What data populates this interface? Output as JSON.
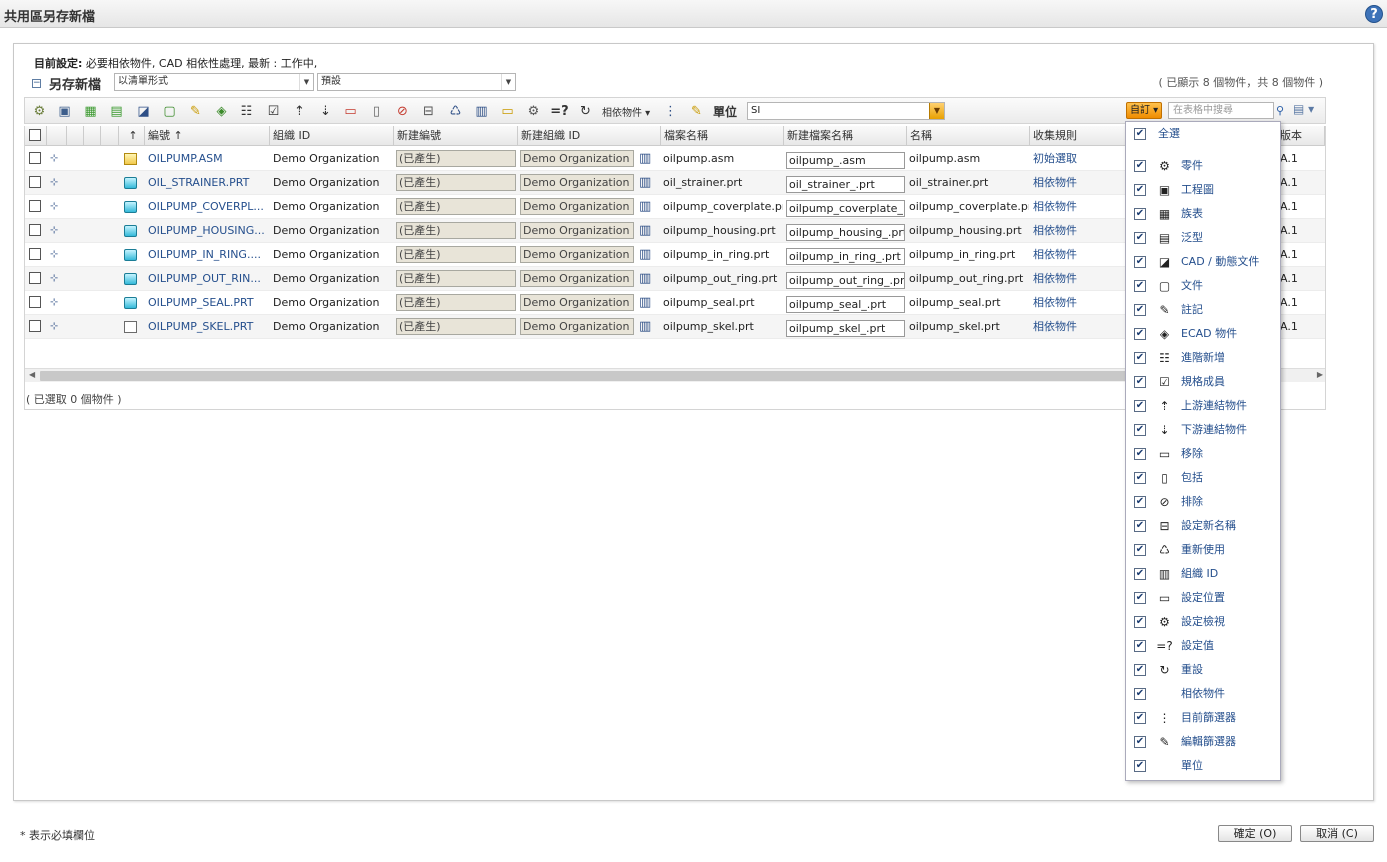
{
  "window": {
    "title": "共用區另存新檔",
    "help_label": "?"
  },
  "current_settings": {
    "label": "目前設定:",
    "value": "必要相依物件, CAD 相依性處理, 最新 : 工作中,"
  },
  "section": {
    "collapse_symbol": "−",
    "title": "另存新檔",
    "mode_select": "以清單形式",
    "preset_select": "預設",
    "shown_count": "( 已顯示 8 個物件，共 8 個物件 )"
  },
  "toolbar": {
    "dependents_label": "相依物件",
    "unit_label": "單位",
    "unit_value": "SI",
    "customize_label": "自訂",
    "search_placeholder": "在表格中搜尋"
  },
  "columns": [
    "↑",
    "編號 ↑",
    "組織 ID",
    "新建編號",
    "新建組織 ID",
    "檔案名稱",
    "新建檔案名稱",
    "名稱",
    "收集規則",
    "版本"
  ],
  "rows": [
    {
      "number": "OILPUMP.ASM",
      "org": "Demo Organization",
      "new_number": "(已產生)",
      "new_org": "Demo Organization",
      "file": "oilpump.asm",
      "new_file": "oilpump_.asm",
      "name": "oilpump.asm",
      "rule": "初始選取",
      "version": "A.1",
      "icon": "assembly"
    },
    {
      "number": "OIL_STRAINER.PRT",
      "org": "Demo Organization",
      "new_number": "(已產生)",
      "new_org": "Demo Organization",
      "file": "oil_strainer.prt",
      "new_file": "oil_strainer_.prt",
      "name": "oil_strainer.prt",
      "rule": "相依物件",
      "version": "A.1",
      "icon": "part"
    },
    {
      "number": "OILPUMP_COVERPL...",
      "org": "Demo Organization",
      "new_number": "(已產生)",
      "new_org": "Demo Organization",
      "file": "oilpump_coverplate.prt",
      "new_file": "oilpump_coverplate_.prt",
      "name": "oilpump_coverplate.prt",
      "rule": "相依物件",
      "version": "A.1",
      "icon": "part"
    },
    {
      "number": "OILPUMP_HOUSING...",
      "org": "Demo Organization",
      "new_number": "(已產生)",
      "new_org": "Demo Organization",
      "file": "oilpump_housing.prt",
      "new_file": "oilpump_housing_.prt",
      "name": "oilpump_housing.prt",
      "rule": "相依物件",
      "version": "A.1",
      "icon": "part"
    },
    {
      "number": "OILPUMP_IN_RING....",
      "org": "Demo Organization",
      "new_number": "(已產生)",
      "new_org": "Demo Organization",
      "file": "oilpump_in_ring.prt",
      "new_file": "oilpump_in_ring_.prt",
      "name": "oilpump_in_ring.prt",
      "rule": "相依物件",
      "version": "A.1",
      "icon": "part"
    },
    {
      "number": "OILPUMP_OUT_RIN...",
      "org": "Demo Organization",
      "new_number": "(已產生)",
      "new_org": "Demo Organization",
      "file": "oilpump_out_ring.prt",
      "new_file": "oilpump_out_ring_.prt",
      "name": "oilpump_out_ring.prt",
      "rule": "相依物件",
      "version": "A.1",
      "icon": "part"
    },
    {
      "number": "OILPUMP_SEAL.PRT",
      "org": "Demo Organization",
      "new_number": "(已產生)",
      "new_org": "Demo Organization",
      "file": "oilpump_seal.prt",
      "new_file": "oilpump_seal_.prt",
      "name": "oilpump_seal.prt",
      "rule": "相依物件",
      "version": "A.1",
      "icon": "part"
    },
    {
      "number": "OILPUMP_SKEL.PRT",
      "org": "Demo Organization",
      "new_number": "(已產生)",
      "new_org": "Demo Organization",
      "file": "oilpump_skel.prt",
      "new_file": "oilpump_skel_.prt",
      "name": "oilpump_skel.prt",
      "rule": "相依物件",
      "version": "A.1",
      "icon": "skeleton"
    }
  ],
  "selected_count": "( 已選取 0 個物件 )",
  "customize_menu": {
    "select_all": "全選",
    "items": [
      {
        "label": "零件",
        "icon": "part-gear-icon"
      },
      {
        "label": "工程圖",
        "icon": "drawing-icon"
      },
      {
        "label": "族表",
        "icon": "family-table-icon"
      },
      {
        "label": "泛型",
        "icon": "generic-icon"
      },
      {
        "label": "CAD / 動態文件",
        "icon": "cad-document-icon"
      },
      {
        "label": "文件",
        "icon": "document-icon"
      },
      {
        "label": "註記",
        "icon": "annotation-icon"
      },
      {
        "label": "ECAD 物件",
        "icon": "ecad-icon"
      },
      {
        "label": "進階新增",
        "icon": "advanced-add-icon"
      },
      {
        "label": "規格成員",
        "icon": "spec-member-icon"
      },
      {
        "label": "上游連結物件",
        "icon": "upstream-icon"
      },
      {
        "label": "下游連結物件",
        "icon": "downstream-icon"
      },
      {
        "label": "移除",
        "icon": "remove-icon"
      },
      {
        "label": "包括",
        "icon": "include-icon"
      },
      {
        "label": "排除",
        "icon": "exclude-icon"
      },
      {
        "label": "設定新名稱",
        "icon": "rename-icon"
      },
      {
        "label": "重新使用",
        "icon": "reuse-icon"
      },
      {
        "label": "組織 ID",
        "icon": "org-id-icon"
      },
      {
        "label": "設定位置",
        "icon": "folder-icon"
      },
      {
        "label": "設定檢視",
        "icon": "view-icon"
      },
      {
        "label": "設定值",
        "icon": "set-value-icon"
      },
      {
        "label": "重設",
        "icon": "reset-icon"
      },
      {
        "label": "相依物件",
        "icon": ""
      },
      {
        "label": "目前篩選器",
        "icon": "current-filter-icon"
      },
      {
        "label": "編輯篩選器",
        "icon": "edit-filter-icon"
      },
      {
        "label": "單位",
        "icon": ""
      }
    ]
  },
  "footer": {
    "required_note": "* 表示必填欄位",
    "ok_label": "確定 (O)",
    "cancel_label": "取消 (C)"
  }
}
